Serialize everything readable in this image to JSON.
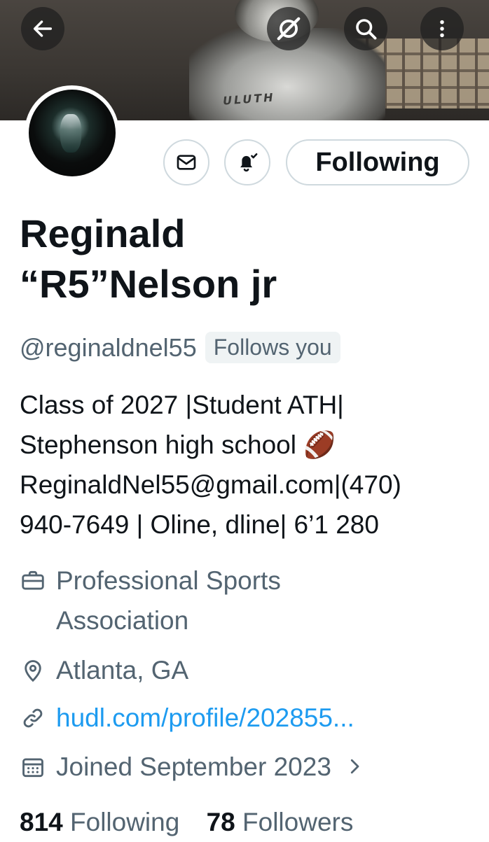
{
  "header": {
    "banner_text": "ULUTH",
    "back_icon": "arrow-left-icon",
    "grok_icon": "grok-slash-icon",
    "search_icon": "search-icon",
    "more_icon": "more-vertical-icon"
  },
  "actions": {
    "message_icon": "envelope-icon",
    "notify_icon": "bell-check-icon",
    "following_label": "Following"
  },
  "profile": {
    "name_line1": "Reginald",
    "name_line2": "“R5”Nelson jr",
    "handle": "@reginaldnel55",
    "follows_you": "Follows you",
    "bio": [
      "Class of 2027 |Student ATH|",
      "Stephenson high school 🏈",
      "ReginaldNel55@gmail.com|(470)",
      "940-7649 | Oline, dline| 6’1 280"
    ],
    "category_line1": "Professional Sports",
    "category_line2": "Association",
    "location": "Atlanta, GA",
    "website": "hudl.com/profile/202855...",
    "joined": "Joined September 2023"
  },
  "stats": {
    "following_count": "814",
    "following_label": "Following",
    "followers_count": "78",
    "followers_label": "Followers"
  },
  "colors": {
    "text": "#0f1419",
    "secondary": "#536471",
    "link": "#1d9bf0",
    "border": "#cfd9de"
  }
}
